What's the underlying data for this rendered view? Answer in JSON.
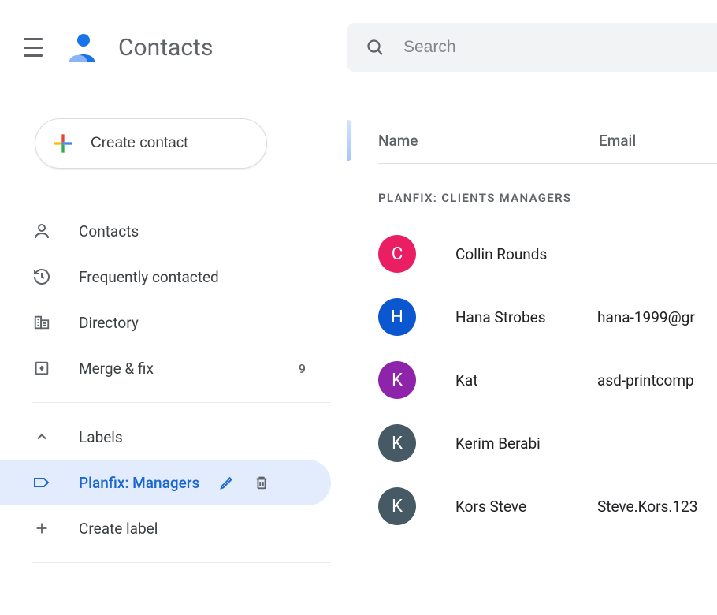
{
  "header": {
    "app_title": "Contacts",
    "search_placeholder": "Search"
  },
  "sidebar": {
    "create_label": "Create contact",
    "nav": [
      {
        "icon": "person",
        "label": "Contacts"
      },
      {
        "icon": "history",
        "label": "Frequently contacted"
      },
      {
        "icon": "domain",
        "label": "Directory"
      },
      {
        "icon": "merge",
        "label": "Merge & fix",
        "badge": "9"
      }
    ],
    "labels_header": "Labels",
    "labels": [
      {
        "label": "Planfix: Managers",
        "selected": true
      }
    ],
    "create_label_label": "Create label"
  },
  "main": {
    "columns": {
      "name": "Name",
      "email": "Email"
    },
    "section_title": "PLANFIX: CLIENTS MANAGERS",
    "contacts": [
      {
        "initial": "C",
        "color": "#e91e63",
        "name": "Collin Rounds",
        "email": ""
      },
      {
        "initial": "H",
        "color": "#0b57d0",
        "name": "Hana Strobes",
        "email": "hana-1999@gr"
      },
      {
        "initial": "K",
        "color": "#8e24aa",
        "name": "Kat",
        "email": "asd-printcomp"
      },
      {
        "initial": "K",
        "color": "#455a64",
        "name": "Kerim Berabi",
        "email": ""
      },
      {
        "initial": "K",
        "color": "#455a64",
        "name": "Kors Steve",
        "email": "Steve.Kors.123"
      }
    ]
  }
}
